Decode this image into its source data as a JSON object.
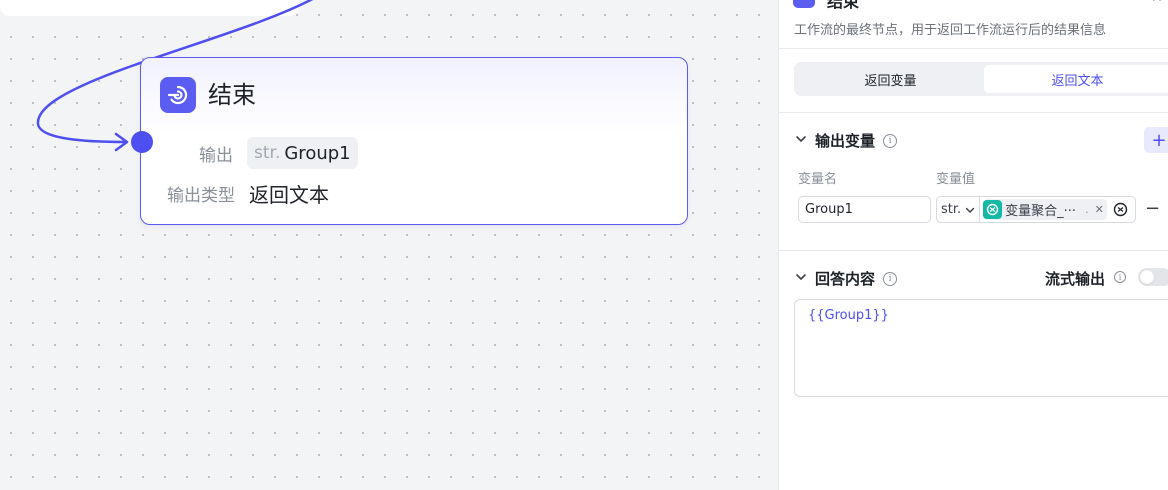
{
  "canvas": {
    "node": {
      "title": "结束",
      "output_label": "输出",
      "output_type_prefix": "str.",
      "output_var": "Group1",
      "type_label": "输出类型",
      "type_value": "返回文本"
    }
  },
  "panel": {
    "title": "结束",
    "description": "工作流的最终节点，用于返回工作流运行后的结果信息",
    "tabs": [
      {
        "label": "返回变量",
        "active": false
      },
      {
        "label": "返回文本",
        "active": true
      }
    ],
    "output_section": {
      "title": "输出变量",
      "col_name": "变量名",
      "col_value": "变量值",
      "rows": [
        {
          "name": "Group1",
          "type": "str.",
          "value": "变量聚合_···",
          "value_suffix": "."
        }
      ]
    },
    "answer_section": {
      "title": "回答内容",
      "stream_label": "流式输出",
      "stream_on": false,
      "content": "{{Group1}}"
    }
  },
  "colors": {
    "accent": "#4e4ff0",
    "node_icon": "#5b5cf2",
    "var_icon": "#14b8a6"
  }
}
